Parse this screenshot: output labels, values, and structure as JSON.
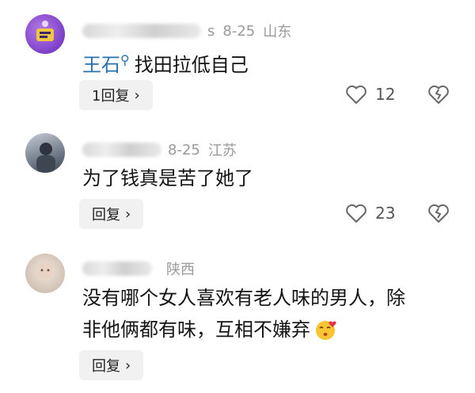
{
  "comments": [
    {
      "username_suffix": "s",
      "date": "8-25",
      "location": "山东",
      "mention": "王石",
      "text": "找田拉低自己",
      "reply_label": "1回复",
      "likes": "12",
      "avatar_color": "#8a4fd0"
    },
    {
      "username_suffix": "",
      "date": "8-25",
      "location": "江苏",
      "mention": "",
      "text": "为了钱真是苦了她了",
      "reply_label": "回复",
      "likes": "23",
      "avatar_color": "#5d6a7a"
    },
    {
      "username_suffix": "",
      "date": "",
      "location": "陕西",
      "mention": "",
      "text_line1": "没有哪个女人喜欢有老人味的男人，除",
      "text_line2": "非他俩都有味，互相不嫌弃",
      "reply_label": "回复",
      "likes": "",
      "avatar_color": "#d7cfc8"
    }
  ],
  "icons": {
    "like": "heart-outline-icon",
    "dislike": "broken-heart-icon",
    "chevron": "chevron-right-icon",
    "emoji": "kiss-emoji-icon"
  }
}
